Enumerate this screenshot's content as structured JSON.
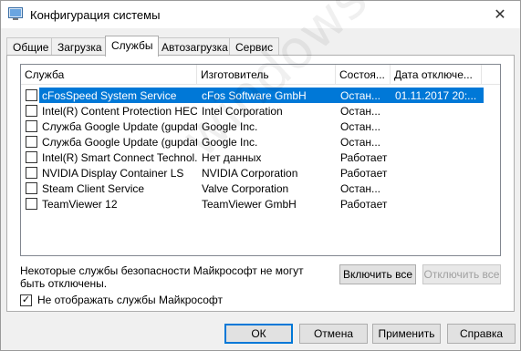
{
  "window": {
    "title": "Конфигурация системы",
    "close_glyph": "✕"
  },
  "tabs": [
    {
      "label": "Общие"
    },
    {
      "label": "Загрузка"
    },
    {
      "label": "Службы"
    },
    {
      "label": "Автозагрузка"
    },
    {
      "label": "Сервис"
    }
  ],
  "active_tab": "Службы",
  "columns": [
    "Служба",
    "Изготовитель",
    "Состоя...",
    "Дата отключе..."
  ],
  "services": [
    {
      "name": "cFosSpeed System Service",
      "vendor": "cFos Software GmbH",
      "status": "Остан...",
      "date": "01.11.2017 20:...",
      "checked": false,
      "selected": true
    },
    {
      "name": "Intel(R) Content Protection HEC...",
      "vendor": "Intel Corporation",
      "status": "Остан...",
      "date": "",
      "checked": false,
      "selected": false
    },
    {
      "name": "Служба Google Update (gupdate)",
      "vendor": "Google Inc.",
      "status": "Остан...",
      "date": "",
      "checked": false,
      "selected": false
    },
    {
      "name": "Служба Google Update (gupdat...",
      "vendor": "Google Inc.",
      "status": "Остан...",
      "date": "",
      "checked": false,
      "selected": false
    },
    {
      "name": "Intel(R) Smart Connect Technol...",
      "vendor": "Нет данных",
      "status": "Работает",
      "date": "",
      "checked": false,
      "selected": false
    },
    {
      "name": "NVIDIA Display Container LS",
      "vendor": "NVIDIA Corporation",
      "status": "Работает",
      "date": "",
      "checked": false,
      "selected": false
    },
    {
      "name": "Steam Client Service",
      "vendor": "Valve Corporation",
      "status": "Остан...",
      "date": "",
      "checked": false,
      "selected": false
    },
    {
      "name": "TeamViewer 12",
      "vendor": "TeamViewer GmbH",
      "status": "Работает",
      "date": "",
      "checked": false,
      "selected": false
    }
  ],
  "note": "Некоторые службы безопасности Майкрософт не могут быть отключены.",
  "buttons": {
    "enable_all": "Включить все",
    "disable_all": "Отключить все",
    "ok": "ОК",
    "cancel": "Отмена",
    "apply": "Применить",
    "help": "Справка"
  },
  "hide_ms": {
    "label": "Не отображать службы Майкрософт",
    "checked": true,
    "check_glyph": "✓"
  },
  "watermark": "windowsten.ru",
  "colors": {
    "selection": "#0078d7",
    "window_bg": "#f0f0f0"
  }
}
